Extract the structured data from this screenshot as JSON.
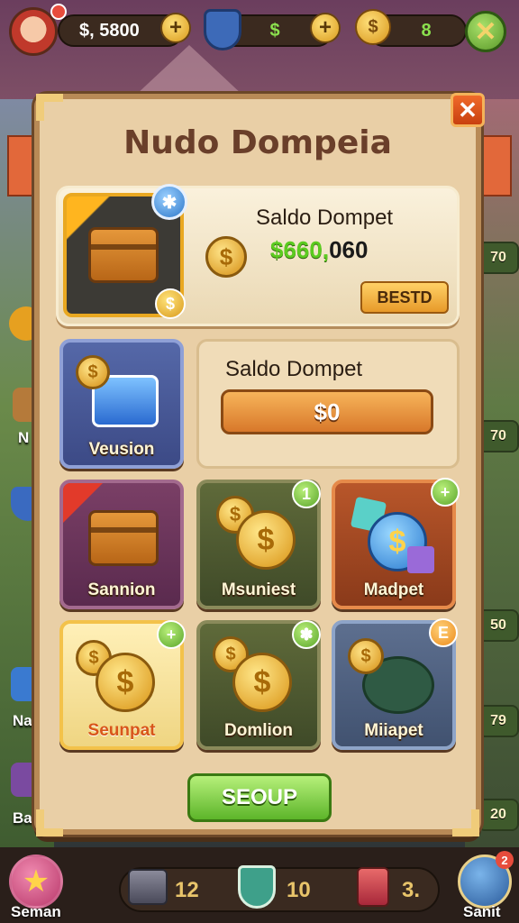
{
  "top_bar": {
    "money": "$, 5800",
    "shield_value": "$",
    "gold_value": "8"
  },
  "panel": {
    "title": "Nudo Dompeia",
    "close_label": "✕"
  },
  "featured": {
    "title": "Saldo Dompet",
    "amount_highlight": "$660,",
    "amount_rest": "060",
    "button_label": "BESTD",
    "blue_badge": "✱",
    "coin_badge": "$"
  },
  "saldo": {
    "title": "Saldo Dompet",
    "button_label": "$0"
  },
  "tiles": [
    {
      "label": "Veusion"
    },
    {
      "label": "Sannion"
    },
    {
      "label": "Msuniest",
      "badge": "1"
    },
    {
      "label": "Madpet",
      "badge": "+"
    },
    {
      "label": "Seunpat",
      "badge": "+"
    },
    {
      "label": "Domlion",
      "badge": "✽"
    },
    {
      "label": "Miiapet",
      "badge": "E"
    }
  ],
  "setup_button": "SEOUP",
  "side_values": [
    "70",
    "70",
    "50",
    "79",
    "20"
  ],
  "side_labels": [
    "N",
    "Na",
    "Ba"
  ],
  "bottom_bar": {
    "left_label": "Seman",
    "item1_value": "12",
    "item2_value": "10",
    "item3_value": "3.",
    "right_label": "Sanit",
    "right_badge": "2"
  }
}
